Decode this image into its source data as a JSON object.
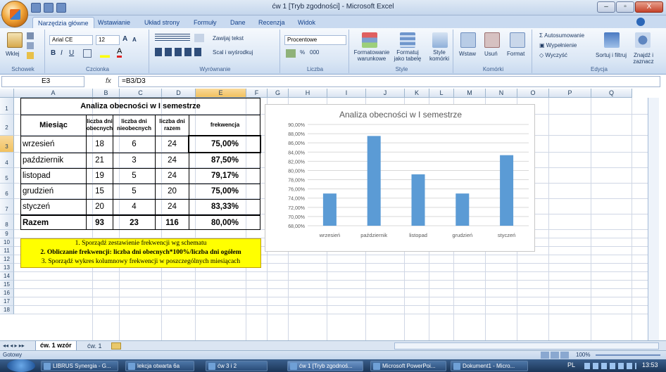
{
  "window": {
    "title": "ćw 1  [Tryb zgodności] - Microsoft Excel",
    "min": "–",
    "max": "▫",
    "close": "X"
  },
  "ribbon_tabs": [
    "Narzędzia główne",
    "Wstawianie",
    "Układ strony",
    "Formuły",
    "Dane",
    "Recenzja",
    "Widok"
  ],
  "ribbon": {
    "clipboard": {
      "paste": "Wklej",
      "label": "Schowek"
    },
    "font": {
      "name": "Arial CE",
      "size": "12",
      "bold": "B",
      "italic": "I",
      "underline": "U",
      "label": "Czcionka"
    },
    "alignment": {
      "wrap": "Zawijaj tekst",
      "merge": "Scal i wyśrodkuj",
      "label": "Wyrównanie"
    },
    "number": {
      "format": "Procentowe",
      "percent": "%",
      "thousands": "000",
      "label": "Liczba"
    },
    "styles": {
      "conditional": "Formatowanie warunkowe",
      "table": "Formatuj jako tabelę",
      "cell": "Style komórki",
      "label": "Style"
    },
    "cells": {
      "insert": "Wstaw",
      "delete": "Usuń",
      "format": "Format",
      "label": "Komórki"
    },
    "editing": {
      "autosum": "Autosumowanie",
      "fill": "Wypełnienie",
      "clear": "Wyczyść",
      "sort": "Sortuj i filtruj",
      "find": "Znajdź i zaznacz",
      "label": "Edycja"
    }
  },
  "formula_bar": {
    "name_box": "E3",
    "fx": "fx",
    "formula": "=B3/D3"
  },
  "columns": [
    "A",
    "B",
    "C",
    "D",
    "E",
    "F",
    "G",
    "H",
    "I",
    "J",
    "K",
    "L",
    "M",
    "N",
    "O",
    "P",
    "Q"
  ],
  "rows": [
    "1",
    "2",
    "3",
    "4",
    "5",
    "6",
    "7",
    "8",
    "9",
    "10",
    "11",
    "12",
    "13",
    "14",
    "15",
    "16",
    "17",
    "18"
  ],
  "table": {
    "title": "Analiza obecności w I semestrze",
    "headers": [
      "Miesiąc",
      "liczba dni obecnych",
      "liczba dni nieobecnych",
      "liczba dni razem",
      "frekwencja"
    ],
    "rows": [
      [
        "wrzesień",
        "18",
        "6",
        "24",
        "75,00%"
      ],
      [
        "październik",
        "21",
        "3",
        "24",
        "87,50%"
      ],
      [
        "listopad",
        "19",
        "5",
        "24",
        "79,17%"
      ],
      [
        "grudzień",
        "15",
        "5",
        "20",
        "75,00%"
      ],
      [
        "styczeń",
        "20",
        "4",
        "24",
        "83,33%"
      ]
    ],
    "total": [
      "Razem",
      "93",
      "23",
      "116",
      "80,00%"
    ]
  },
  "tasks": [
    "1. Sporządź zestawienie frekwencji wg schematu",
    "2. Obliczanie frekwencji: liczba dni obecnych*100%/liczba dni ogółem",
    "3. Sporządź wykres kolumnowy frekwencji w poszczególnych miesiącach"
  ],
  "chart_data": {
    "type": "bar",
    "title": "Analiza obecności w I semestrze",
    "categories": [
      "wrzesień",
      "październik",
      "listopad",
      "grudzień",
      "styczeń"
    ],
    "values": [
      75.0,
      87.5,
      79.17,
      75.0,
      83.33
    ],
    "ylim": [
      68,
      90
    ],
    "yticks": [
      "90,00%",
      "88,00%",
      "86,00%",
      "84,00%",
      "82,00%",
      "80,00%",
      "78,00%",
      "76,00%",
      "74,00%",
      "72,00%",
      "70,00%",
      "68,00%"
    ],
    "bar_color": "#5b9bd5",
    "grid": true
  },
  "sheet_tabs": [
    "ćw. 1 wzór",
    "ćw. 1"
  ],
  "status": {
    "left": "Gotowy",
    "zoom": "100%"
  },
  "taskbar": {
    "items": [
      "LIBRUS Synergia - G...",
      "lekcja otwarta 6a",
      "ćw 3 i 2",
      "ćw 1 [Tryb zgodnoś...",
      "Microsoft PowerPoi...",
      "Dokument1 - Micro..."
    ],
    "lang": "PL",
    "clock": "13:53"
  }
}
